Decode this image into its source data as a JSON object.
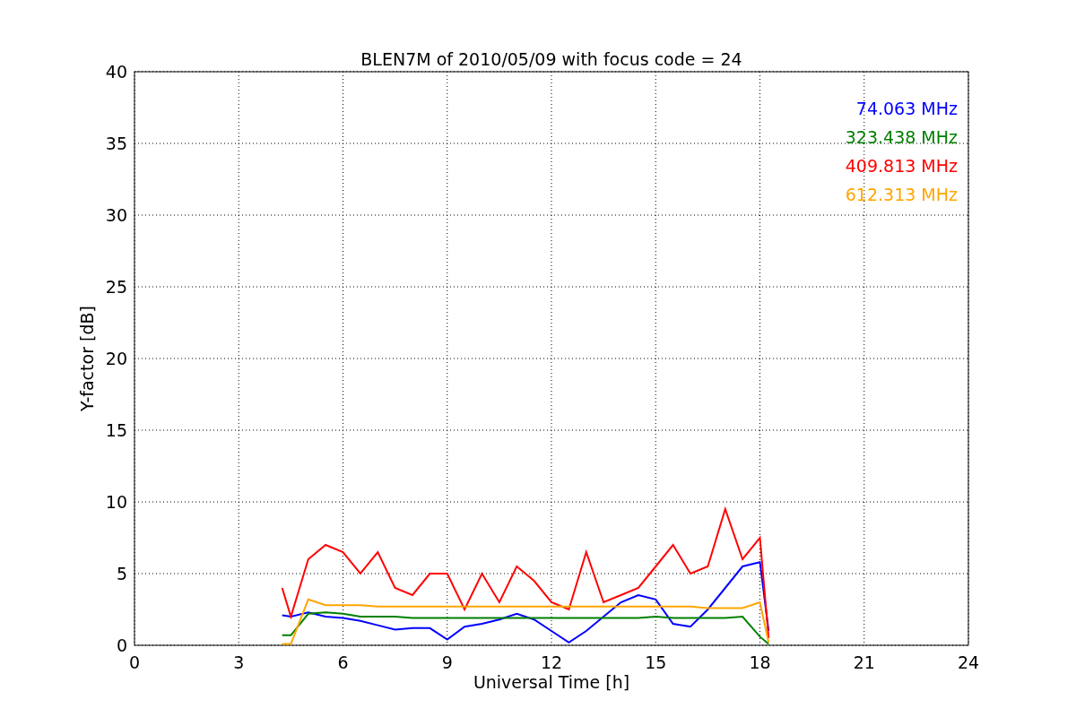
{
  "chart": {
    "chart_data": {
      "type": "line",
      "title": "BLEN7M of 2010/05/09 with focus code = 24",
      "xlabel": "Universal Time [h]",
      "ylabel": "Y-factor [dB]",
      "x": [
        4.25,
        4.5,
        5,
        5.5,
        6,
        6.5,
        7,
        7.5,
        8,
        8.5,
        9,
        9.5,
        10,
        10.5,
        11,
        11.5,
        12,
        12.5,
        13,
        13.5,
        14,
        14.5,
        15,
        15.5,
        16,
        16.5,
        17,
        17.5,
        18,
        18.25
      ],
      "series": [
        {
          "name": "74.063 MHz",
          "color": "#0000ff",
          "values": [
            2.1,
            2.0,
            2.3,
            2.0,
            1.9,
            1.7,
            1.4,
            1.1,
            1.2,
            1.2,
            0.4,
            1.3,
            1.5,
            1.8,
            2.2,
            1.8,
            1.0,
            0.2,
            1.0,
            2.0,
            3.0,
            3.5,
            3.2,
            1.5,
            1.3,
            2.5,
            4.0,
            5.5,
            5.8,
            1.0
          ]
        },
        {
          "name": "323.438 MHz",
          "color": "#008000",
          "values": [
            0.7,
            0.7,
            2.2,
            2.3,
            2.2,
            2.0,
            2.0,
            2.0,
            1.9,
            1.9,
            1.9,
            1.9,
            1.9,
            1.9,
            1.9,
            1.9,
            1.9,
            1.9,
            1.9,
            1.9,
            1.9,
            1.9,
            2.0,
            1.9,
            1.9,
            1.9,
            1.9,
            2.0,
            0.6,
            0.1
          ]
        },
        {
          "name": "409.813 MHz",
          "color": "#ff0000",
          "values": [
            4.0,
            2.0,
            6.0,
            7.0,
            6.5,
            5.0,
            6.5,
            4.0,
            3.5,
            5.0,
            5.0,
            2.5,
            5.0,
            3.0,
            5.5,
            4.5,
            3.0,
            2.5,
            6.5,
            3.0,
            3.5,
            4.0,
            5.5,
            7.0,
            5.0,
            5.5,
            9.5,
            6.0,
            7.5,
            0.5
          ]
        },
        {
          "name": "612.313 MHz",
          "color": "#ffa500",
          "values": [
            0.1,
            0.1,
            3.2,
            2.8,
            2.8,
            2.8,
            2.7,
            2.7,
            2.7,
            2.7,
            2.7,
            2.7,
            2.7,
            2.7,
            2.7,
            2.7,
            2.7,
            2.7,
            2.7,
            2.7,
            2.7,
            2.7,
            2.7,
            2.7,
            2.7,
            2.6,
            2.6,
            2.6,
            3.0,
            0.2
          ]
        }
      ],
      "xlim": [
        0,
        24
      ],
      "ylim": [
        0,
        40
      ],
      "xticks": [
        0,
        3,
        6,
        9,
        12,
        15,
        18,
        21,
        24
      ],
      "yticks": [
        0,
        5,
        10,
        15,
        20,
        25,
        30,
        35,
        40
      ],
      "grid": true
    }
  }
}
